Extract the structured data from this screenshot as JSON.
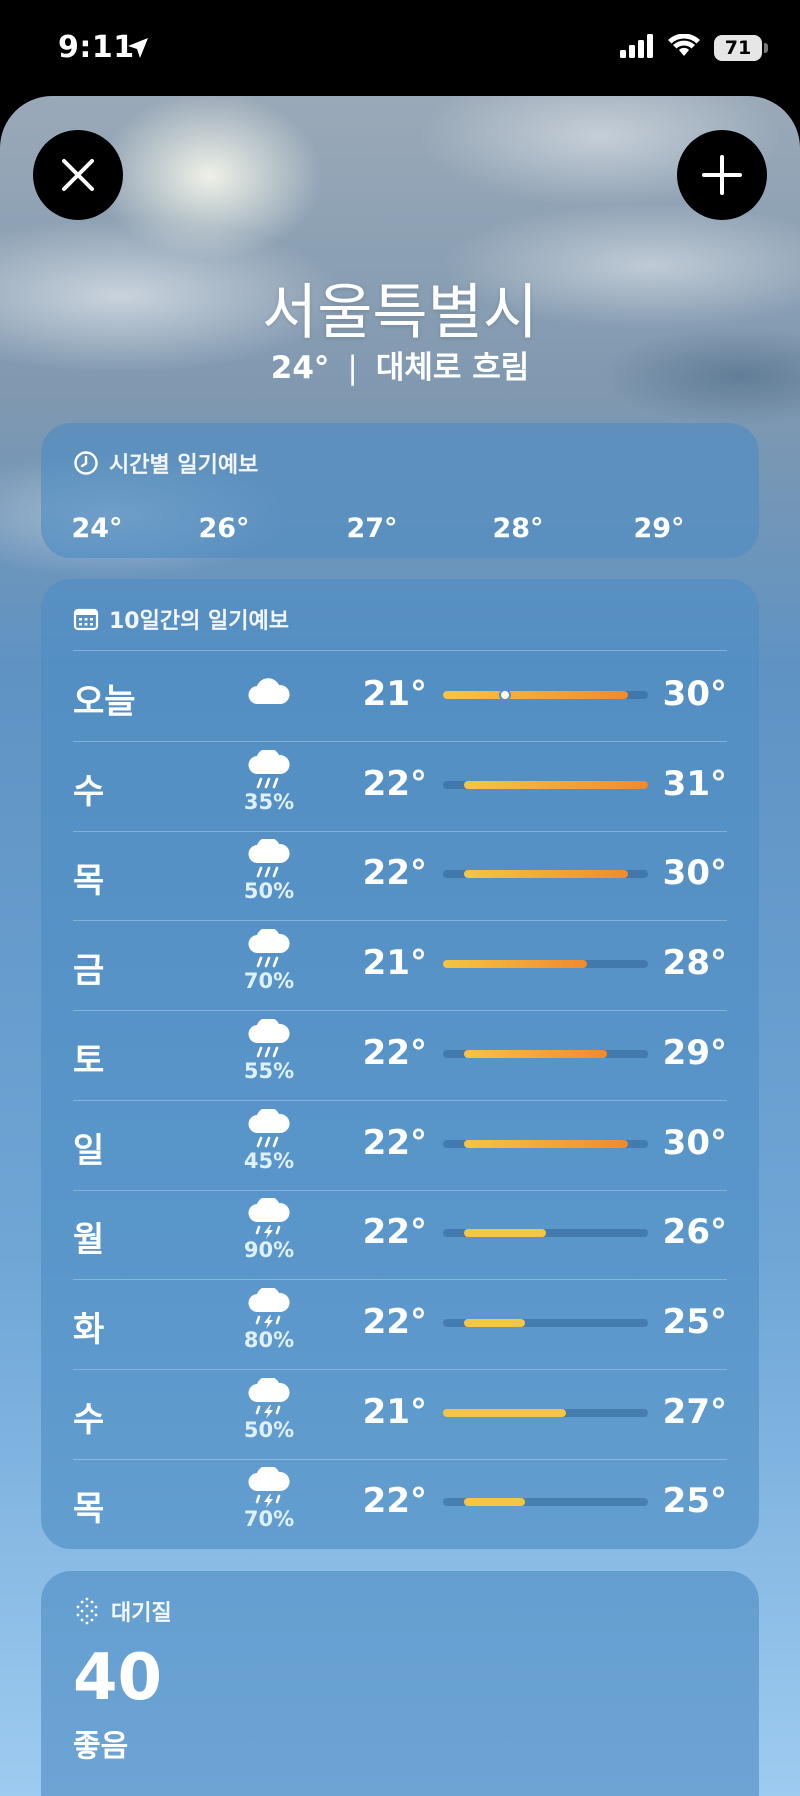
{
  "status_bar": {
    "time": "9:11",
    "battery": "71"
  },
  "location": {
    "city": "서울특별시",
    "temperature": "24°",
    "separator": "|",
    "condition": "대체로 흐림"
  },
  "hourly": {
    "title": "시간별 일기예보",
    "temps": [
      "24°",
      "26°",
      "27°",
      "28°",
      "29°"
    ]
  },
  "daily": {
    "title": "10일간의 일기예보",
    "range_min": 21,
    "range_max": 31,
    "days": [
      {
        "day": "오늘",
        "icon": "cloud-icon",
        "precip": "",
        "low": "21°",
        "high": "30°",
        "low_val": 21,
        "high_val": 30,
        "current": 24
      },
      {
        "day": "수",
        "icon": "rain-icon",
        "precip": "35%",
        "low": "22°",
        "high": "31°",
        "low_val": 22,
        "high_val": 31
      },
      {
        "day": "목",
        "icon": "rain-icon",
        "precip": "50%",
        "low": "22°",
        "high": "30°",
        "low_val": 22,
        "high_val": 30
      },
      {
        "day": "금",
        "icon": "rain-icon",
        "precip": "70%",
        "low": "21°",
        "high": "28°",
        "low_val": 21,
        "high_val": 28
      },
      {
        "day": "토",
        "icon": "rain-icon",
        "precip": "55%",
        "low": "22°",
        "high": "29°",
        "low_val": 22,
        "high_val": 29
      },
      {
        "day": "일",
        "icon": "rain-icon",
        "precip": "45%",
        "low": "22°",
        "high": "30°",
        "low_val": 22,
        "high_val": 30
      },
      {
        "day": "월",
        "icon": "thunderstorm-icon",
        "precip": "90%",
        "low": "22°",
        "high": "26°",
        "low_val": 22,
        "high_val": 26
      },
      {
        "day": "화",
        "icon": "thunderstorm-icon",
        "precip": "80%",
        "low": "22°",
        "high": "25°",
        "low_val": 22,
        "high_val": 25
      },
      {
        "day": "수",
        "icon": "thunderstorm-icon",
        "precip": "50%",
        "low": "21°",
        "high": "27°",
        "low_val": 21,
        "high_val": 27
      },
      {
        "day": "목",
        "icon": "thunderstorm-icon",
        "precip": "70%",
        "low": "22°",
        "high": "25°",
        "low_val": 22,
        "high_val": 25
      }
    ]
  },
  "air_quality": {
    "title": "대기질",
    "value": "40",
    "status": "좋음"
  },
  "colors": {
    "bar_cool": "#f5c544",
    "bar_warm": "#f08a2e"
  }
}
